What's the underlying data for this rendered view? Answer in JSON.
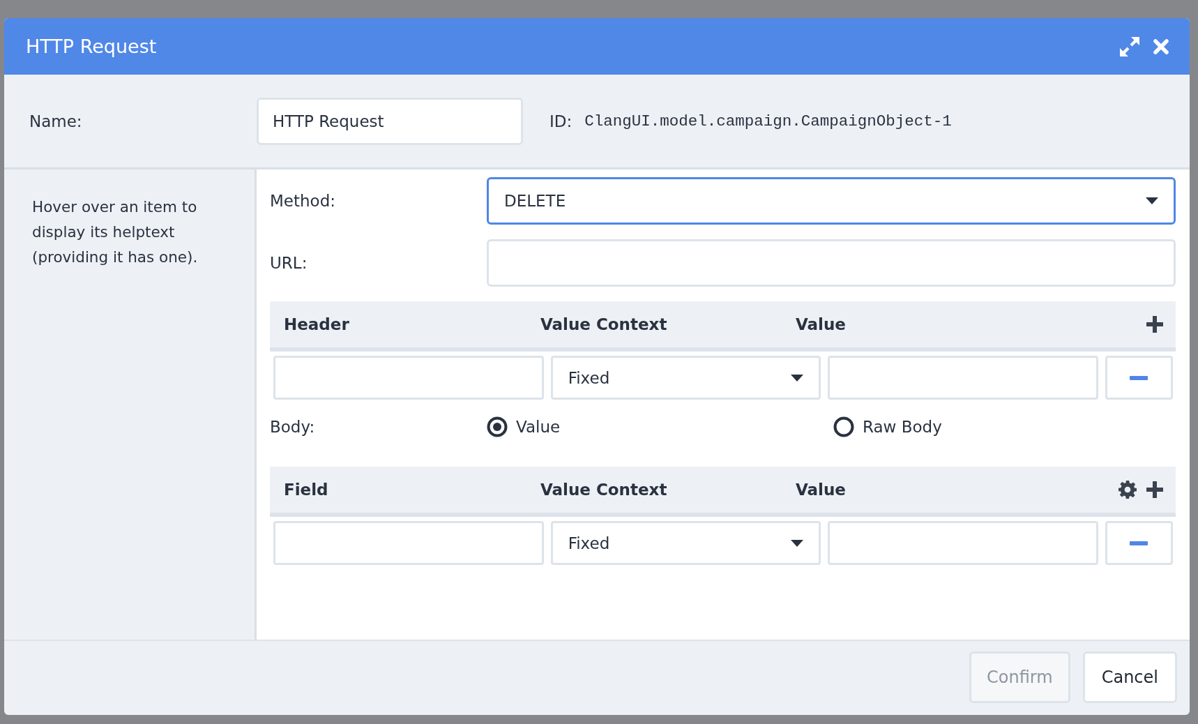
{
  "window": {
    "title": "HTTP Request"
  },
  "name_row": {
    "label": "Name:",
    "value": "HTTP Request",
    "id_label": "ID:",
    "id_value": "ClangUI.model.campaign.CampaignObject-1"
  },
  "help_text": "Hover over an item to display its helptext (providing it has one).",
  "method": {
    "label": "Method:",
    "value": "DELETE",
    "focused": true
  },
  "url": {
    "label": "URL:"
  },
  "headers_table": {
    "columns": [
      "Header",
      "Value Context",
      "Value"
    ],
    "show_settings": false,
    "rows": [
      {
        "context": "Fixed"
      }
    ]
  },
  "body": {
    "label": "Body:",
    "options": [
      {
        "label": "Value",
        "selected": true
      },
      {
        "label": "Raw Body",
        "selected": false
      }
    ]
  },
  "fields_table": {
    "columns": [
      "Field",
      "Value Context",
      "Value"
    ],
    "show_settings": true,
    "rows": [
      {
        "context": "Fixed"
      }
    ]
  },
  "buttons": [
    {
      "label": "Confirm",
      "disabled": true
    },
    {
      "label": "Cancel",
      "disabled": false
    }
  ]
}
